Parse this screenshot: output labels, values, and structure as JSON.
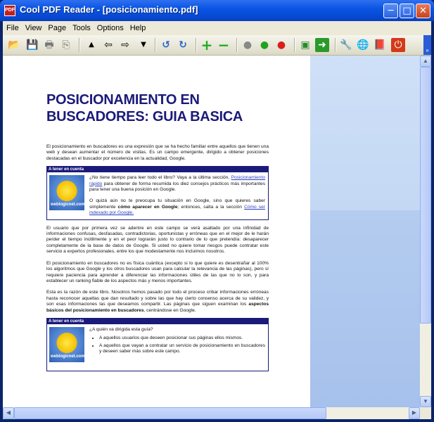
{
  "window": {
    "title": "Cool PDF Reader - [posicionamiento.pdf]",
    "app_icon": "PDF"
  },
  "title_buttons": {
    "minimize": "─",
    "maximize": "□",
    "close": "✕"
  },
  "menu": {
    "items": [
      "File",
      "View",
      "Page",
      "Tools",
      "Options",
      "Help"
    ]
  },
  "toolbar": {
    "icons": {
      "open": "📂",
      "save": "💾",
      "print": "🖶",
      "copy": "⎘",
      "up": "▲",
      "back": "⇦",
      "forward": "⇨",
      "down": "▼",
      "rotate_left": "↺",
      "rotate_right": "↻",
      "zoom_in": "+",
      "zoom_out": "−",
      "gray": "●",
      "green": "●",
      "red": "●",
      "fit": "▣",
      "go": "➜",
      "tools": "🔧",
      "web": "🌐",
      "book": "📕",
      "exit": "⏻"
    },
    "chevron": "»"
  },
  "document": {
    "title": "POSICIONAMIENTO EN BUSCADORES: GUIA BASICA",
    "intro": "El posicionamiento en buscadores es una expresión que se ha hecho familiar entre aquellos que tienen una web y desean aumentar el número de visitas. Es un campo emergente, dirigido a obtener posiciones destacadas en el buscador por excelencia en la actualidad, Google.",
    "box1": {
      "header": "A tener en cuenta",
      "thumb_text": "weblogicnet.com",
      "p1_a": "¿No tiene tiempo para leer todo el libro? Vaya a la última sección, ",
      "p1_link": "Posicionamiento rápido",
      "p1_b": " para obtener de forma resumida los diez consejos prácticos más importantes para tener una buena posición en Google.",
      "p2_a": "O quizá aún no te preocupa tu situación en Google, sino que quieres saber simplemente ",
      "p2_bold": "cómo aparecer en Google",
      "p2_b": "; entonces, salta a la sección ",
      "p2_link": "Cómo ser indexado por Google."
    },
    "para2": "El usuario que por primera vez se adentre en este campo se verá asaltado por una infinidad de informaciones confusas, desfasadas, contradictorias, oportunistas y erróneas que en el mejor de le harán perder el tiempo inútilmente y en el peor lograrán justo lo contrario de lo que pretendía: desaparecer completamente de la base de datos de Google. Si usted no quiere tomar riesgos puede contratar este servicio a expertos profesionales, entre los que modestamente nos incluimos nosotros.",
    "para3": "El posicionamiento en buscadores no es física cuántica (excepto si lo que quiere es desentrañar al 100% los algoritmos que Google y los otros buscadores usan para calcular la relevancia de las páginas), pero sí requiere paciencia para aprender a diferenciar las informaciones útiles de las que no lo son, y para establecer un ranking fiable de los aspectos más y menos importantes.",
    "para4_a": "Esta es la razón de este libro. Nosotros hemos pasado por todo el proceso cribar informaciones erróneas hasta reconocer aquellas que dan resultado y sobre las que hay cierto consenso acerca de su validez, y son esas informaciones las que deseamos compartir. Las páginas que siguen examinan los ",
    "para4_bold": "aspectos básicos del posicionamiento en buscadores",
    "para4_b": ", centrándose en Google.",
    "box2": {
      "header": "A tener en cuenta",
      "thumb_text": "weblogicnet.com",
      "question": "¿A quién va dirigida esta guía?",
      "bullets": [
        "A aquellos usuarios que deseen posicionar sus páginas ellos mismos.",
        "A aquellos que vayan a contratar un servicio de posicionamiento en buscadores y deseen saber más sobre este campo."
      ]
    }
  },
  "scrollbars": {
    "up": "▲",
    "down": "▼",
    "left": "◀",
    "right": "▶"
  }
}
